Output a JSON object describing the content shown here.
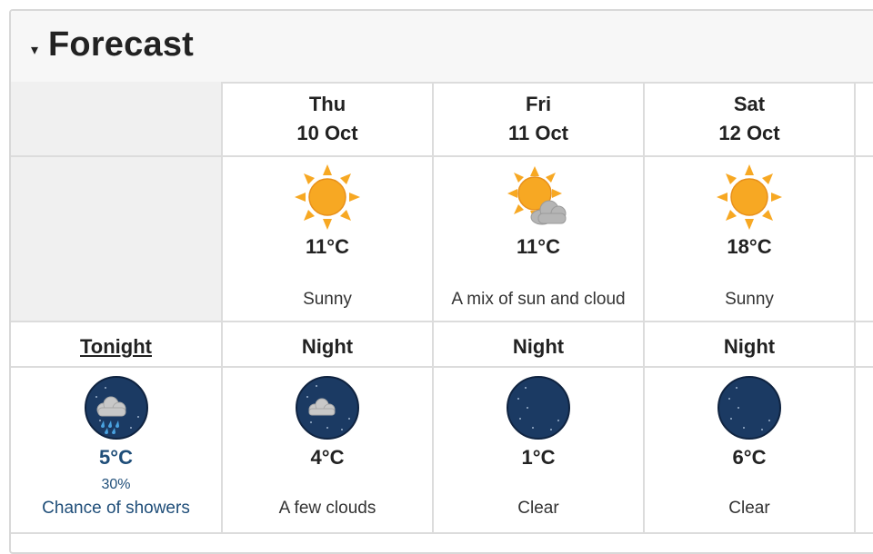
{
  "panel": {
    "toggle_glyph": "▾",
    "title": "Forecast"
  },
  "days": [
    {
      "dow": "Thu",
      "date": "10 Oct",
      "temp": "11°C",
      "condition": "Sunny",
      "icon": "sun-icon"
    },
    {
      "dow": "Fri",
      "date": "11 Oct",
      "temp": "11°C",
      "condition": "A mix of sun and cloud",
      "icon": "sun-cloud-icon"
    },
    {
      "dow": "Sat",
      "date": "12 Oct",
      "temp": "18°C",
      "condition": "Sunny",
      "icon": "sun-icon"
    }
  ],
  "tonight": {
    "label": "Tonight",
    "temp": "5°C",
    "pop": "30%",
    "condition": "Chance of showers",
    "icon": "night-showers-icon"
  },
  "nights": [
    {
      "label": "Night",
      "temp": "4°C",
      "condition": "A few clouds",
      "icon": "night-cloud-icon"
    },
    {
      "label": "Night",
      "temp": "1°C",
      "condition": "Clear",
      "icon": "night-clear-icon"
    },
    {
      "label": "Night",
      "temp": "6°C",
      "condition": "Clear",
      "icon": "night-clear-icon"
    }
  ],
  "colors": {
    "sun": "#f7a823",
    "night_bg": "#1b3a63",
    "link_blue": "#1f4e79",
    "border": "#dcdcdc",
    "gray_cell": "#f0f0f0"
  }
}
